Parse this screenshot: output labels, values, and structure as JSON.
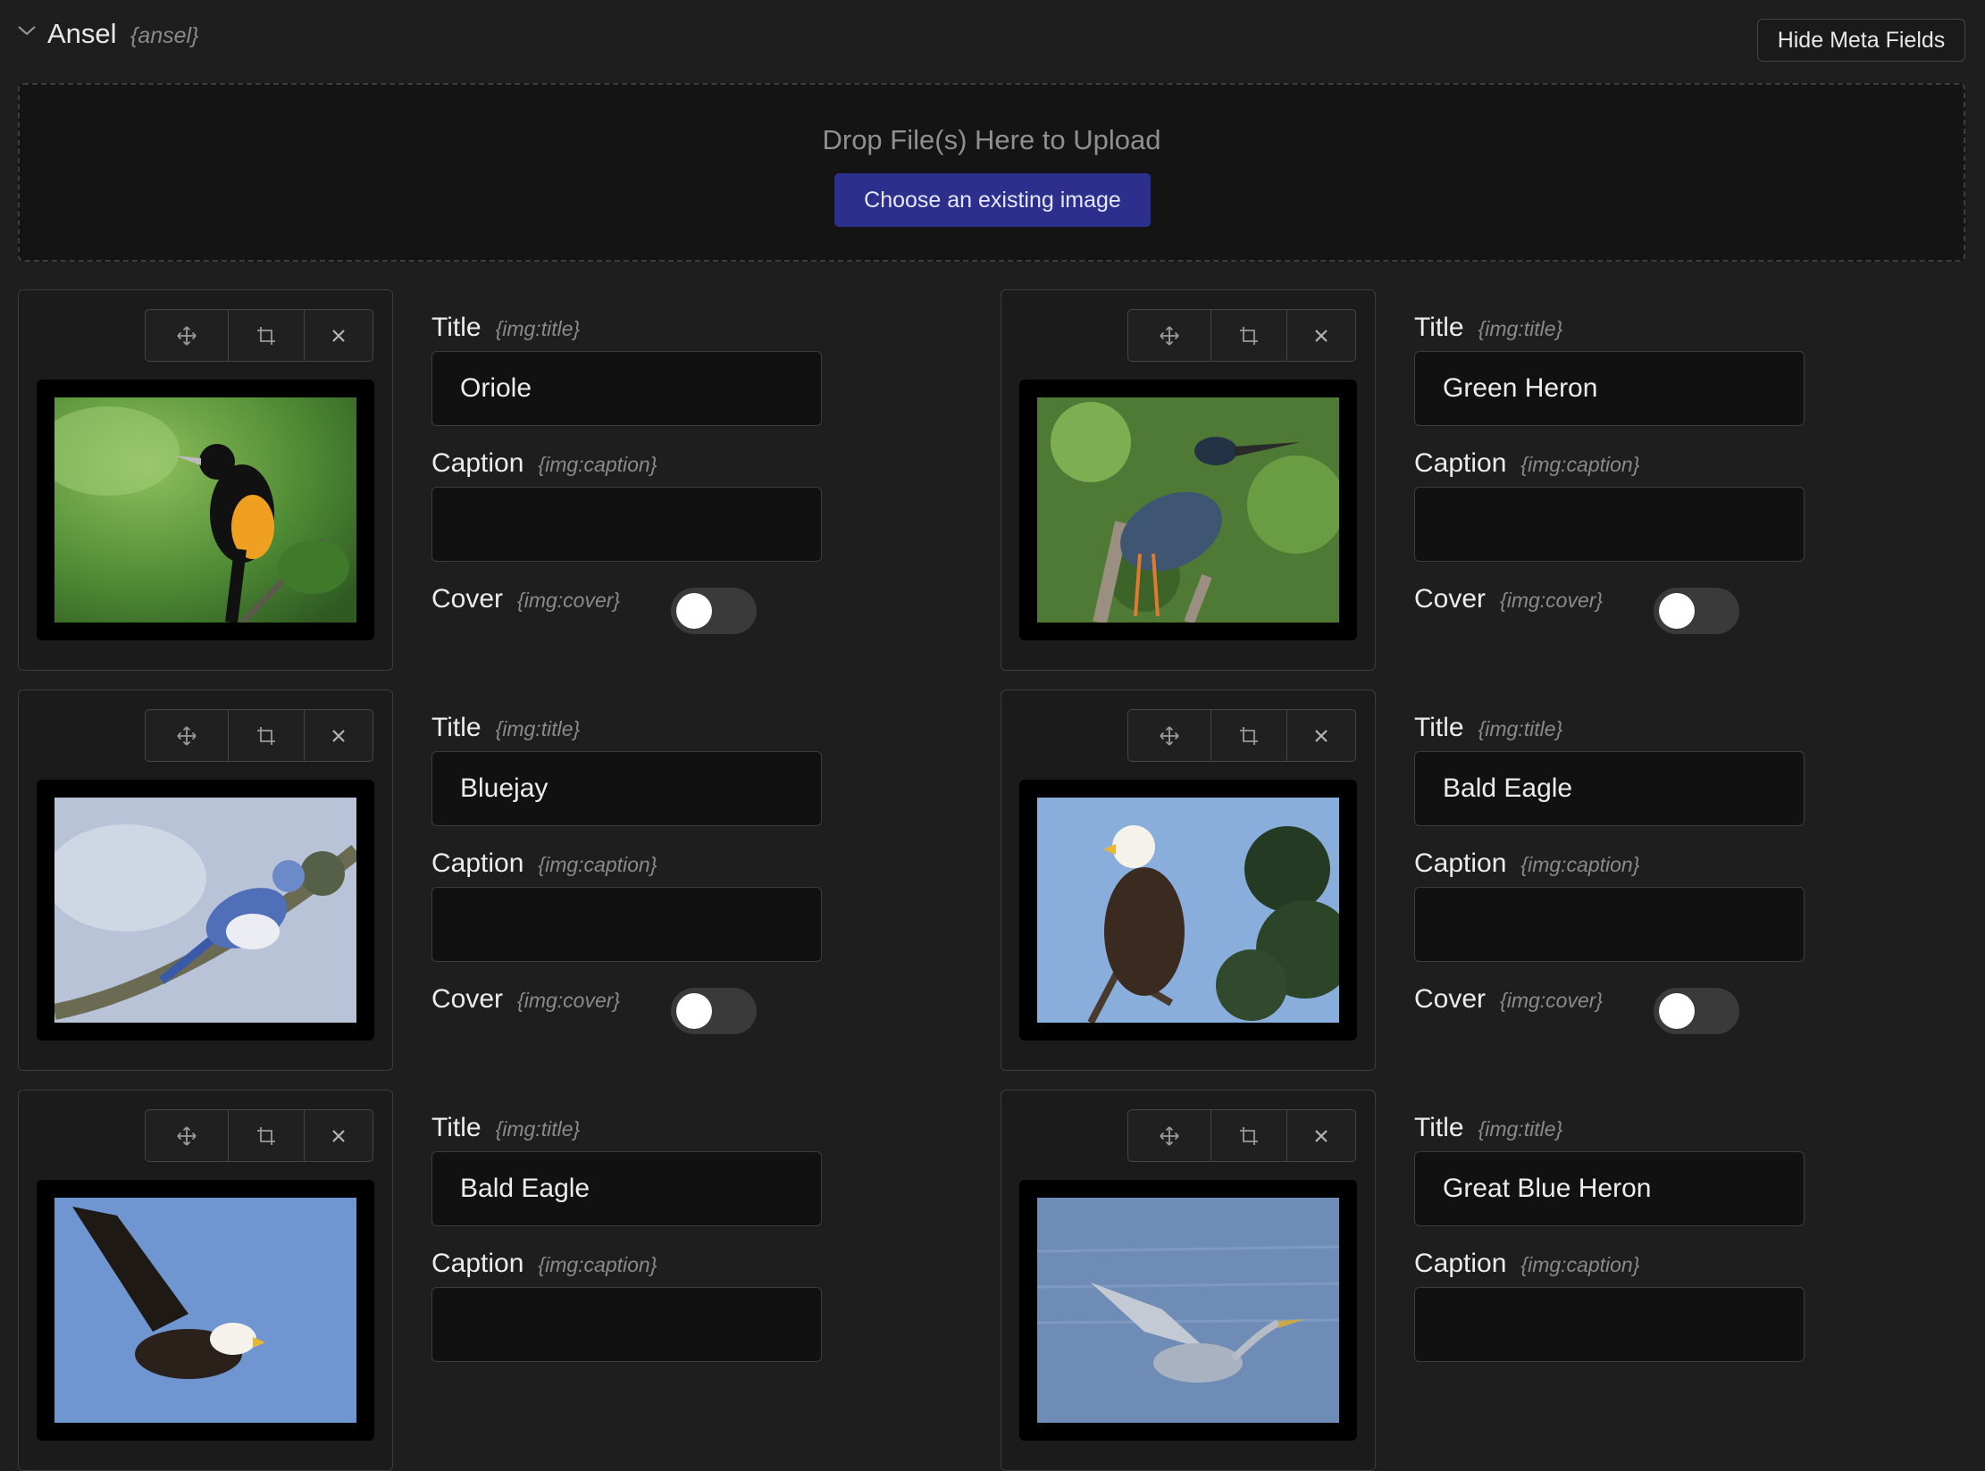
{
  "field": {
    "name": "Ansel",
    "handle": "{ansel}"
  },
  "hide_meta_label": "Hide Meta Fields",
  "dropzone": {
    "text": "Drop File(s) Here to Upload",
    "choose_label": "Choose an existing image"
  },
  "labels": {
    "title": "Title",
    "title_tag": "{img:title}",
    "caption": "Caption",
    "caption_tag": "{img:caption}",
    "cover": "Cover",
    "cover_tag": "{img:cover}"
  },
  "icons": {
    "move": "move-icon",
    "crop": "crop-icon",
    "remove": "close-icon",
    "collapse": "chevron-down-icon"
  },
  "colors": {
    "accent": "#2c2f8c",
    "background": "#1e1e1e"
  },
  "images": [
    {
      "title": "Oriole",
      "caption": "",
      "cover": false,
      "photo": "oriole"
    },
    {
      "title": "Green Heron",
      "caption": "",
      "cover": false,
      "photo": "green-heron"
    },
    {
      "title": "Bluejay",
      "caption": "",
      "cover": false,
      "photo": "bluejay"
    },
    {
      "title": "Bald Eagle",
      "caption": "",
      "cover": false,
      "photo": "bald-eagle-perched"
    },
    {
      "title": "Bald Eagle",
      "caption": "",
      "cover": false,
      "photo": "bald-eagle-flying"
    },
    {
      "title": "Great Blue Heron",
      "caption": "",
      "cover": false,
      "photo": "great-blue-heron"
    }
  ]
}
